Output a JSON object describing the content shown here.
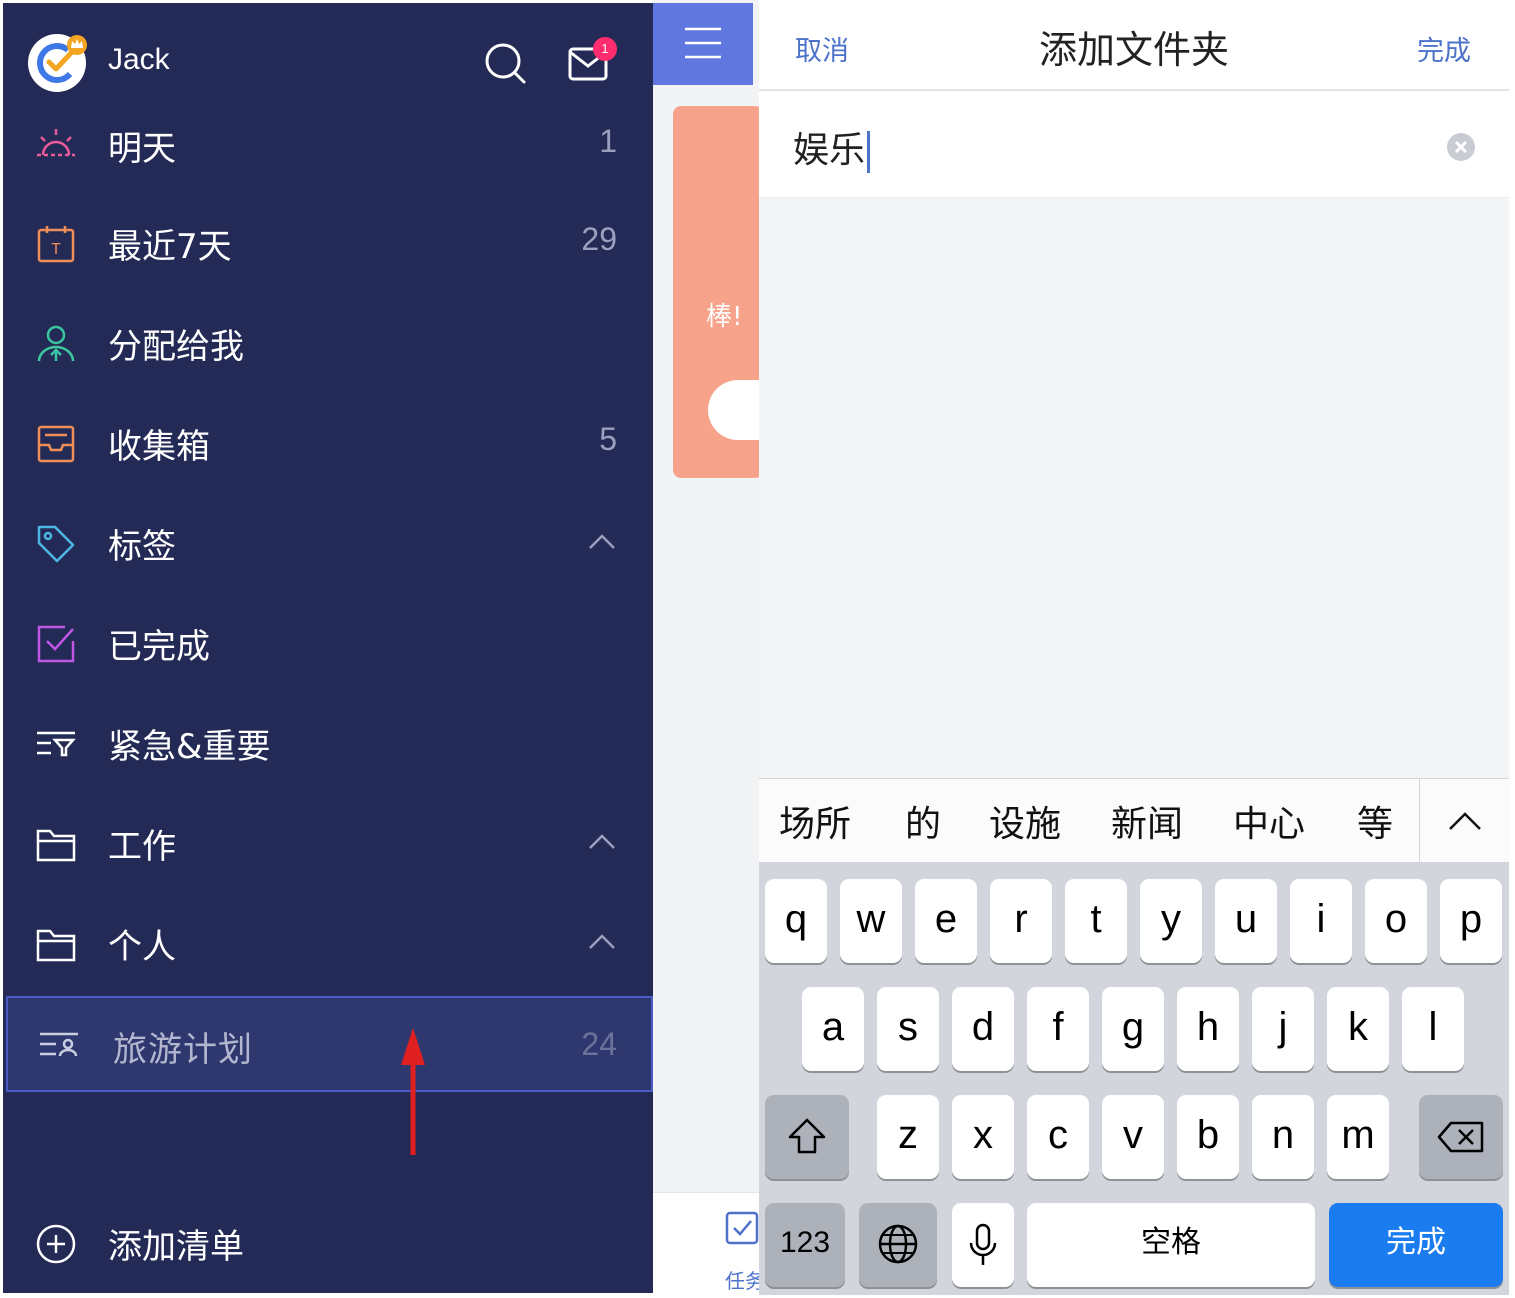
{
  "sidebar": {
    "user_name": "Jack",
    "mail_badge": "1",
    "items": [
      {
        "label": "明天",
        "count": "1",
        "icon": "sunrise-icon",
        "color": "#e85b9a"
      },
      {
        "label": "最近7天",
        "count": "29",
        "icon": "calendar-t-icon",
        "color": "#f08e5a"
      },
      {
        "label": "分配给我",
        "count": "",
        "icon": "assigned-person-icon",
        "color": "#3cc6a0"
      },
      {
        "label": "收集箱",
        "count": "5",
        "icon": "inbox-icon",
        "color": "#f08e5a"
      },
      {
        "label": "标签",
        "count": "",
        "icon": "tag-icon",
        "color": "#4db6e8"
      },
      {
        "label": "已完成",
        "count": "",
        "icon": "completed-check-icon",
        "color": "#c156e6"
      },
      {
        "label": "紧急&重要",
        "count": "",
        "icon": "filter-list-icon",
        "color": "#ffffff"
      },
      {
        "label": "工作",
        "count": "",
        "icon": "folder-icon",
        "color": "#ffffff"
      },
      {
        "label": "个人",
        "count": "",
        "icon": "folder-icon",
        "color": "#ffffff"
      }
    ],
    "dragging_item": {
      "label": "旅游计划",
      "count": "24"
    },
    "add_list_label": "添加清单"
  },
  "middle": {
    "card_text": "棒!",
    "bottom_tab_label": "任务"
  },
  "dialog": {
    "cancel_label": "取消",
    "title": "添加文件夹",
    "done_label": "完成",
    "input_value": "娱乐"
  },
  "keyboard": {
    "candidates": [
      "场所",
      "的",
      "设施",
      "新闻",
      "中心",
      "等"
    ],
    "row1": [
      "q",
      "w",
      "e",
      "r",
      "t",
      "y",
      "u",
      "i",
      "o",
      "p"
    ],
    "row2": [
      "a",
      "s",
      "d",
      "f",
      "g",
      "h",
      "j",
      "k",
      "l"
    ],
    "row3": [
      "z",
      "x",
      "c",
      "v",
      "b",
      "n",
      "m"
    ],
    "num_label": "123",
    "space_label": "空格",
    "return_label": "完成"
  },
  "colors": {
    "sidebar_bg": "#232a55",
    "accent_blue": "#4d72c9",
    "return_blue": "#1b7cf0",
    "arrow_red": "#e02020"
  }
}
